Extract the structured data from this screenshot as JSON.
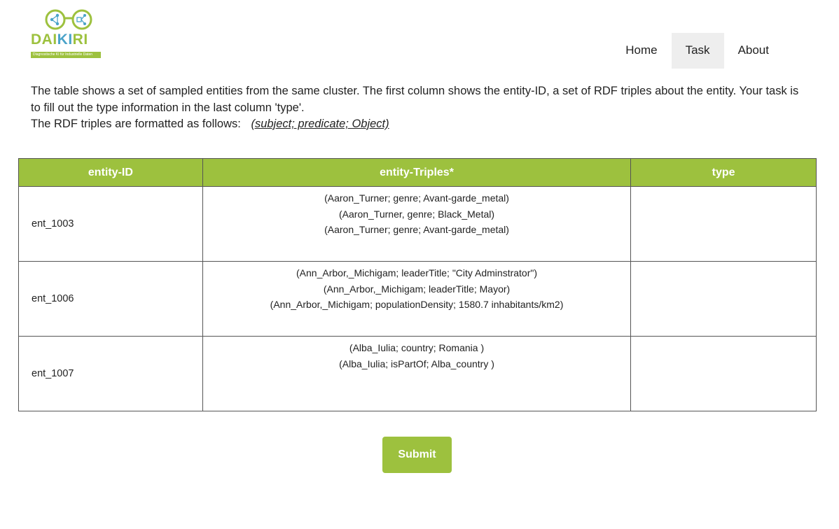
{
  "brand": {
    "logo_prefix": "DAI",
    "logo_middle": "KI",
    "logo_suffix": "RI",
    "tagline": "Diagnostische KI für Industrielle Daten",
    "primary_color": "#9dc13e",
    "accent_color": "#4aa3c9"
  },
  "nav": {
    "items": [
      {
        "label": "Home",
        "active": false
      },
      {
        "label": "Task",
        "active": true
      },
      {
        "label": "About",
        "active": false
      }
    ]
  },
  "intro": {
    "text": "The table shows a set of sampled entities from the same cluster. The first column shows the entity-ID, a set of RDF triples about the entity. Your task is to fill out the type information in the last column 'type'.",
    "format_label": "The RDF triples are formatted as follows:",
    "format_example": "(subject; predicate; Object)"
  },
  "table": {
    "headers": [
      "entity-ID",
      "entity-Triples*",
      "type"
    ],
    "rows": [
      {
        "id": "ent_1003",
        "triples": [
          "(Aaron_Turner; genre; Avant-garde_metal)",
          "(Aaron_Turner, genre; Black_Metal)",
          "(Aaron_Turner; genre; Avant-garde_metal)"
        ],
        "type": ""
      },
      {
        "id": "ent_1006",
        "triples": [
          "(Ann_Arbor,_Michigam; leaderTitle; \"City Adminstrator\")",
          "(Ann_Arbor,_Michigam; leaderTitle; Mayor)",
          "(Ann_Arbor,_Michigam; populationDensity; 1580.7 inhabitants/km2)"
        ],
        "type": ""
      },
      {
        "id": "ent_1007",
        "triples": [
          "(Alba_Iulia; country; Romania )",
          "(Alba_Iulia; isPartOf; Alba_country )"
        ],
        "type": ""
      }
    ]
  },
  "submit": {
    "label": "Submit"
  }
}
